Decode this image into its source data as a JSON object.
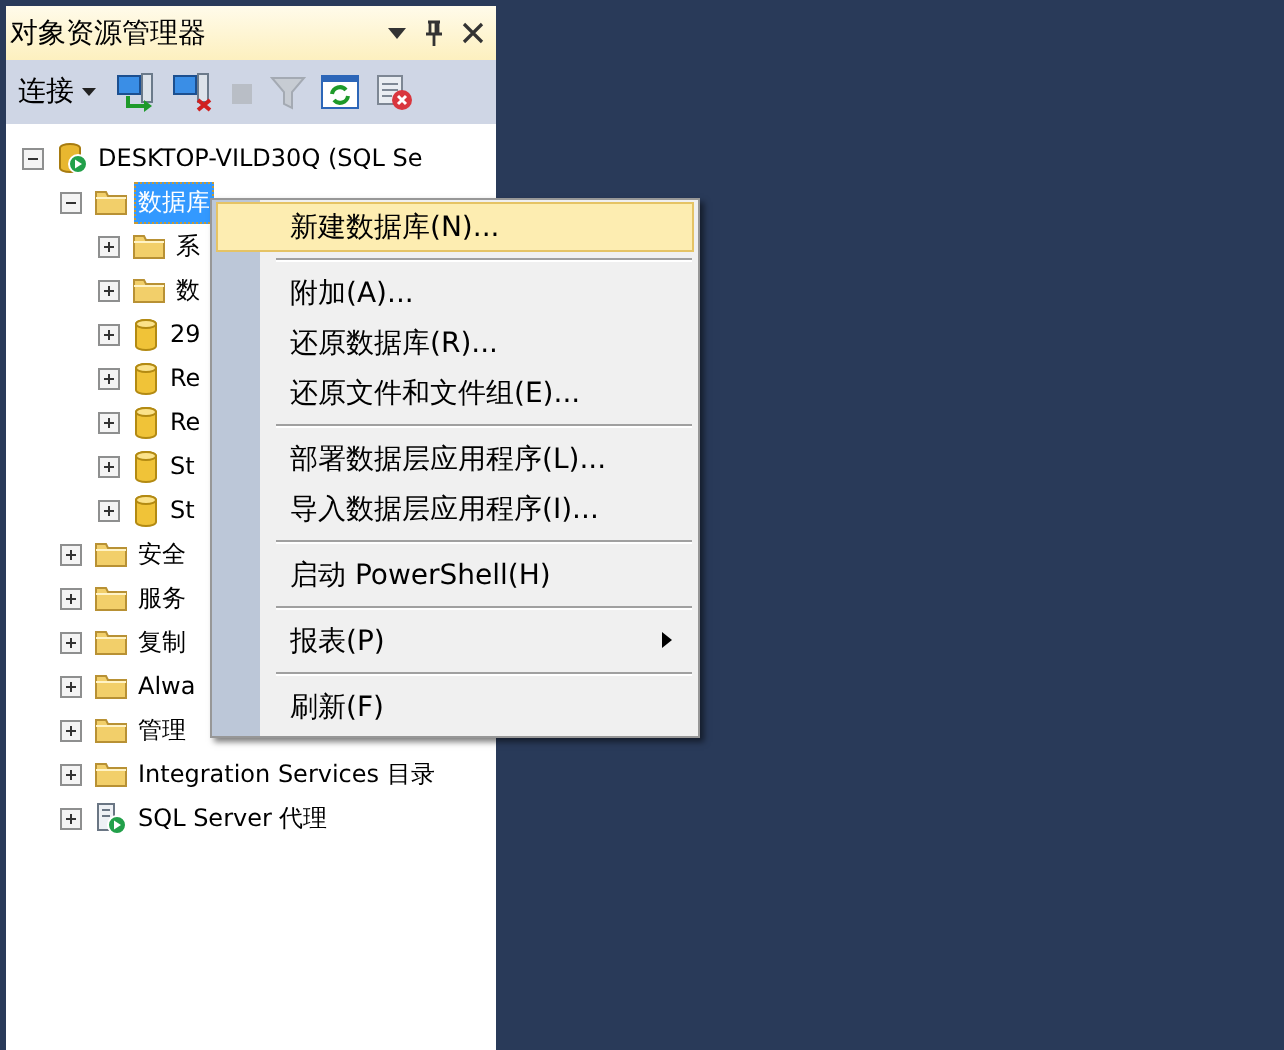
{
  "panel": {
    "title": "对象资源管理器",
    "toolbar": {
      "connect_label": "连接"
    },
    "tree": [
      {
        "label": "DESKTOP-VILD30Q (SQL Se",
        "kind": "server",
        "expanded": true,
        "selected": false,
        "children": [
          {
            "label": "数据库",
            "kind": "folder",
            "expanded": true,
            "selected": true,
            "children": [
              {
                "label": "系",
                "kind": "folder",
                "expanded": false,
                "selected": false
              },
              {
                "label": "数",
                "kind": "folder",
                "expanded": false,
                "selected": false
              },
              {
                "label": "29",
                "kind": "database",
                "expanded": false,
                "selected": false
              },
              {
                "label": "Re",
                "kind": "database",
                "expanded": false,
                "selected": false
              },
              {
                "label": "Re",
                "kind": "database",
                "expanded": false,
                "selected": false
              },
              {
                "label": "St",
                "kind": "database",
                "expanded": false,
                "selected": false
              },
              {
                "label": "St",
                "kind": "database",
                "expanded": false,
                "selected": false
              }
            ]
          },
          {
            "label": "安全",
            "kind": "folder",
            "expanded": false,
            "selected": false
          },
          {
            "label": "服务",
            "kind": "folder",
            "expanded": false,
            "selected": false
          },
          {
            "label": "复制",
            "kind": "folder",
            "expanded": false,
            "selected": false
          },
          {
            "label": "Alwa",
            "kind": "folder",
            "expanded": false,
            "selected": false
          },
          {
            "label": "管理",
            "kind": "folder",
            "expanded": false,
            "selected": false
          },
          {
            "label": "Integration Services 目录",
            "kind": "folder",
            "expanded": false,
            "selected": false
          },
          {
            "label": "SQL Server 代理",
            "kind": "agent",
            "expanded": false,
            "selected": false
          }
        ]
      }
    ]
  },
  "context_menu": {
    "items": [
      {
        "kind": "item",
        "label": "新建数据库(N)...",
        "selected": true,
        "submenu": false
      },
      {
        "kind": "separator"
      },
      {
        "kind": "item",
        "label": "附加(A)...",
        "selected": false,
        "submenu": false
      },
      {
        "kind": "item",
        "label": "还原数据库(R)...",
        "selected": false,
        "submenu": false
      },
      {
        "kind": "item",
        "label": "还原文件和文件组(E)...",
        "selected": false,
        "submenu": false
      },
      {
        "kind": "separator"
      },
      {
        "kind": "item",
        "label": "部署数据层应用程序(L)...",
        "selected": false,
        "submenu": false
      },
      {
        "kind": "item",
        "label": "导入数据层应用程序(I)...",
        "selected": false,
        "submenu": false
      },
      {
        "kind": "separator"
      },
      {
        "kind": "item",
        "label": "启动 PowerShell(H)",
        "selected": false,
        "submenu": false
      },
      {
        "kind": "separator"
      },
      {
        "kind": "item",
        "label": "报表(P)",
        "selected": false,
        "submenu": true
      },
      {
        "kind": "separator"
      },
      {
        "kind": "item",
        "label": "刷新(F)",
        "selected": false,
        "submenu": false
      }
    ]
  }
}
